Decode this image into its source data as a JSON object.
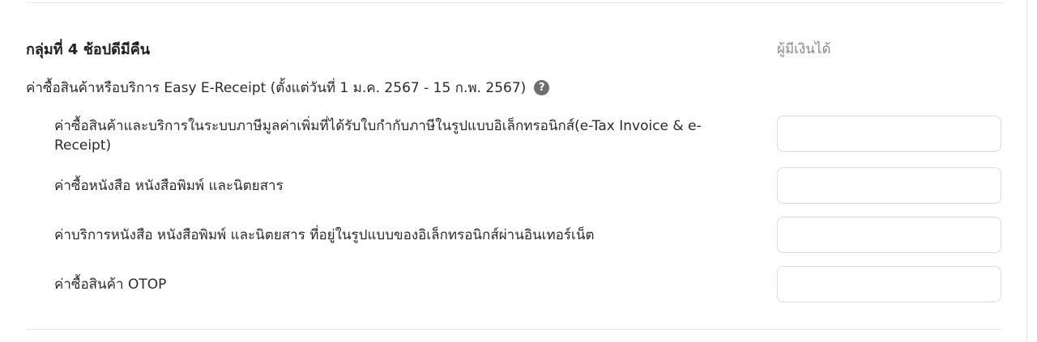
{
  "group": {
    "title": "กลุ่มที่ 4 ช้อปดีมีคืน",
    "column_header": "ผู้มีเงินได้"
  },
  "section": {
    "title": "ค่าซื้อสินค้าหรือบริการ Easy E-Receipt (ตั้งแต่วันที่ 1 ม.ค. 2567 - 15 ก.พ. 2567)",
    "help_icon_glyph": "?"
  },
  "items": [
    {
      "label_line1": "ค่าซื้อสินค้าและบริการในระบบภาษีมูลค่าเพิ่มที่ได้รับใบกำกับภาษีในรูปแบบอิเล็กทรอนิกส์(e-Tax Invoice & e-",
      "label_line2": "Receipt)",
      "value": ""
    },
    {
      "label": "ค่าซื้อหนังสือ หนังสือพิมพ์ และนิตยสาร",
      "value": ""
    },
    {
      "label": "ค่าบริการหนังสือ หนังสือพิมพ์ และนิตยสาร ที่อยู่ในรูปแบบของอิเล็กทรอนิกส์ผ่านอินเทอร์เน็ต",
      "value": ""
    },
    {
      "label": "ค่าซื้อสินค้า OTOP",
      "value": ""
    }
  ]
}
